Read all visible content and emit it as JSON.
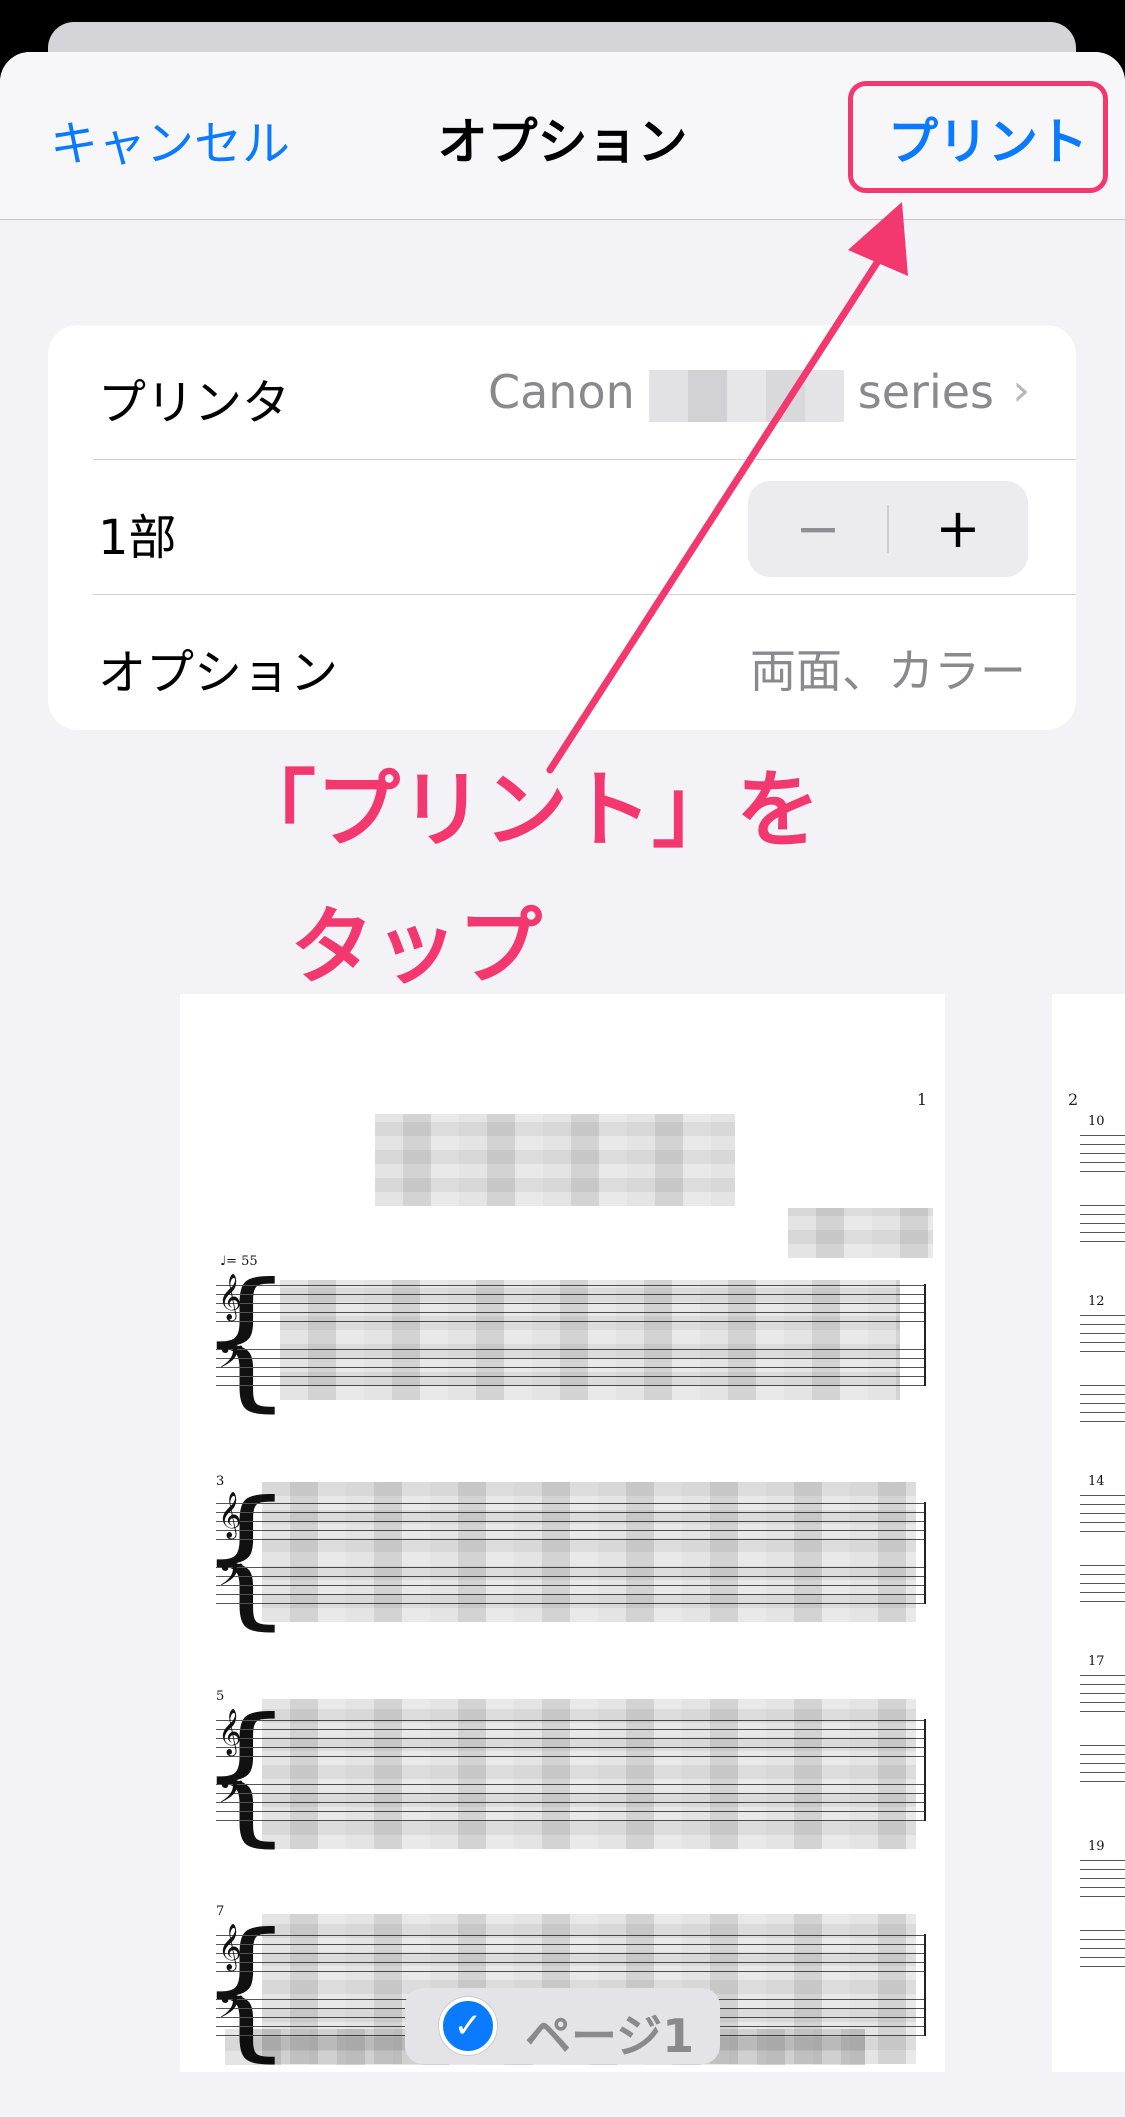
{
  "navbar": {
    "cancel_label": "キャンセル",
    "title": "オプション",
    "print_label": "プリント"
  },
  "settings": {
    "printer_label": "プリンタ",
    "printer_value_prefix": "Canon",
    "printer_value_suffix": "series",
    "copies_label": "1部",
    "stepper_minus": "−",
    "stepper_plus": "+",
    "options_label": "オプション",
    "options_value": "両面、カラー"
  },
  "annotation": {
    "line1": "「プリント」を",
    "line2": "タップ",
    "color": "#f2386f"
  },
  "preview": {
    "page1_number": "1",
    "page2_number": "2",
    "tempo_marking": "♩= 55",
    "page1_measures": [
      "3",
      "5",
      "7"
    ],
    "page2_measures": [
      "10",
      "12",
      "14",
      "17",
      "19"
    ],
    "selected_page_label": "ページ1"
  },
  "colors": {
    "accent": "#0a7aff",
    "annotation": "#f2386f"
  }
}
